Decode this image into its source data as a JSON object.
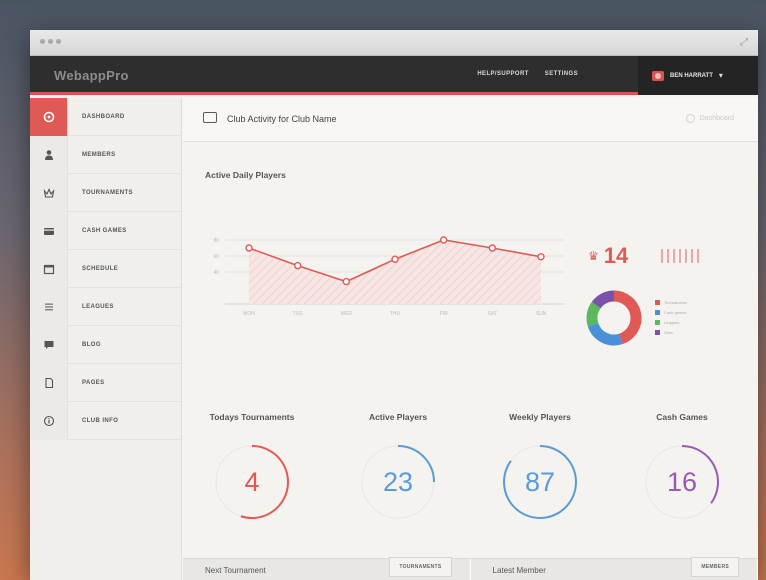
{
  "app": {
    "brand": "WebappPro"
  },
  "topnav": {
    "items": [
      "HELP/SUPPORT",
      "SETTINGS"
    ]
  },
  "user": {
    "name": "BEN HARRATT"
  },
  "sidebar": {
    "items": [
      {
        "label": "DASHBOARD",
        "icon": "dashboard-icon"
      },
      {
        "label": "MEMBERS",
        "icon": "member-icon"
      },
      {
        "label": "TOURNAMENTS",
        "icon": "crown-icon"
      },
      {
        "label": "CASH GAMES",
        "icon": "cash-icon"
      },
      {
        "label": "SCHEDULE",
        "icon": "calendar-icon"
      },
      {
        "label": "LEAGUES",
        "icon": "list-icon"
      },
      {
        "label": "BLOG",
        "icon": "chat-icon"
      },
      {
        "label": "PAGES",
        "icon": "page-icon"
      },
      {
        "label": "CLUB INFO",
        "icon": "info-icon"
      }
    ]
  },
  "panel": {
    "title": "Club Activity for Club Name",
    "right_label": "Dashboard"
  },
  "active_daily": {
    "title": "Active Daily Players",
    "count": "14"
  },
  "chart_data": {
    "type": "area",
    "title": "Active Daily Players",
    "categories": [
      "MON",
      "TUE",
      "WED",
      "THU",
      "FRI",
      "SAT",
      "SUN"
    ],
    "series": [
      {
        "values": [
          70,
          48,
          28,
          56,
          80,
          70,
          59
        ]
      }
    ],
    "ylim": [
      0,
      100
    ],
    "yticks": [
      "80",
      "60",
      "40"
    ],
    "color": "#e05a55"
  },
  "donut": {
    "segments": [
      {
        "label": "Tournaments",
        "value": 45,
        "color": "#e05a55"
      },
      {
        "label": "Cash games",
        "value": 25,
        "color": "#4a90d9"
      },
      {
        "label": "Leagues",
        "value": 15,
        "color": "#5cb85c"
      },
      {
        "label": "Sites",
        "value": 15,
        "color": "#7b52ab"
      }
    ]
  },
  "stats": [
    {
      "title": "Todays Tournaments",
      "value": "4",
      "color": "#e05a55",
      "fraction": 0.55
    },
    {
      "title": "Active Players",
      "value": "23",
      "color": "#5b9bd5",
      "fraction": 0.25
    },
    {
      "title": "Weekly Players",
      "value": "87",
      "color": "#5b9bd5",
      "fraction": 0.85
    },
    {
      "title": "Cash Games",
      "value": "16",
      "color": "#9b59b6",
      "fraction": 0.35
    }
  ],
  "bottom": {
    "left": {
      "title": "Next Tournament",
      "button": "TOURNAMENTS"
    },
    "right": {
      "title": "Latest Member",
      "button": "MEMBERS"
    }
  }
}
